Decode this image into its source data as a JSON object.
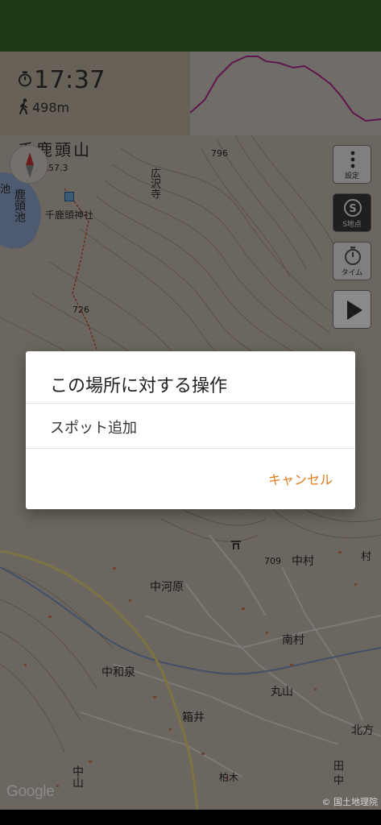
{
  "hud": {
    "time": "17:37",
    "distance": "498m",
    "time_icon": "stopwatch-icon",
    "walk_icon": "walking-person-icon"
  },
  "map_labels": {
    "mountain": "千鹿頭山",
    "elev_left": "57.3",
    "pond": "鹿頭池",
    "pond_left": "池",
    "shrine": "千鹿頭神社",
    "temple": "広沢寺",
    "elev_796": "796",
    "elev_726": "726",
    "elev_709": "709",
    "nakagawara": "中河原",
    "nakamura": "中村",
    "minamimura": "南村",
    "nakawaizumi": "中和泉",
    "maruyama": "丸山",
    "kitagata": "北方",
    "hakoi": "箱井",
    "kashiwagi": "柏木",
    "nakayama": "中山",
    "ta": "田",
    "naka": "中",
    "mura": "村"
  },
  "side_buttons": {
    "settings_label": "設定",
    "s_point_label": "S地点",
    "timer_label": "タイム"
  },
  "dialog": {
    "title": "この場所に対する操作",
    "item_add_spot": "スポット追加",
    "cancel": "キャンセル"
  },
  "footer": {
    "google": "Google",
    "copyright": "© 国土地理院"
  },
  "colors": {
    "accent_orange": "#e07b1a",
    "status_bar": "#1d3b14",
    "profile_line": "#b02a8e"
  }
}
